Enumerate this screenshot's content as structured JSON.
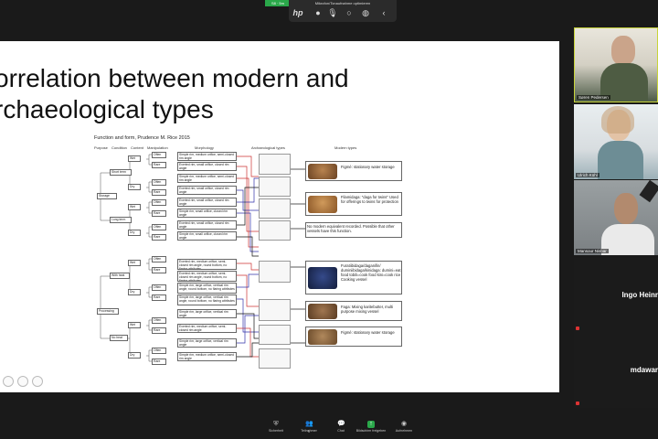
{
  "toolbar": {
    "green_tag": "S8 · 5m",
    "label": "Mikrofon/Tonaufnahme optimieren",
    "hp_icon": "hp"
  },
  "slide": {
    "title_line1": "orrelation between modern and",
    "title_line2": "rchaeological types",
    "subtitle": "Function and form, Prudence M. Rice 2015",
    "headers": {
      "purpose": "Purpose",
      "condition": "Condition",
      "content": "Content",
      "manipulation": "Manipulation",
      "morphology": "Morphology",
      "arch": "Archaeological types",
      "modern": "Modern types"
    },
    "nodes": {
      "storage": "Storage",
      "short_term": "Short term",
      "long_term": "Long term",
      "processing": "Processing",
      "with_heat": "With heat",
      "no_heat": "No heat",
      "wet": "Wet",
      "dry": "Dry",
      "often": "Often",
      "rare": "Rare"
    },
    "morph": [
      "Simple rim, medium orifice, semi-closed rim angle",
      "Everted rim, small orifice, closed rim angle",
      "Simple rim, medium orifice, semi-closed rim angle",
      "Everted rim, small orifice, closed rim angle",
      "Everted rim, small orifice, closed rim angle",
      "Simple rim, small orifice, closed rim angle",
      "Everted rim, small orifice, closed rim angle",
      "Simple rim, small orifice, closed rim angle",
      "Everted rim, medium orifice, semi-closed rim angle, round bottom, no flaring attributes",
      "Everted rim, medium orifice, semi-closed rim angle, round bottom, no flaring attributes",
      "Simple rim, large orifice, vertical rim angle, round bottom, no flaring attributes",
      "Simple rim, large orifice, vertical rim angle, round bottom, no flaring attributes",
      "Simple rim, large orifice, vertical rim angle",
      "Everted rim, medium orifice, semi-closed rim angle",
      "Simple rim, large orifice, vertical rim angle",
      "Simple rim, medium orifice, semi-closed rim angle"
    ],
    "modern": [
      "Figmé: stationary water storage",
      "Filamidaga: \"daga for twins\" Used for offerings to twins for protection",
      "No modern equivalent recorded. Possible that other vessels have this function.",
      "Furatiibidaga/daganifin/ duminiibidaga/kinidaga: dumini=eat food tobili=cook food kini=cook rice Cooking vessel",
      "Faga: Mixing karitebutter, multi purpose mixing vessel",
      "Figmé: stationary water storage"
    ]
  },
  "participants": [
    {
      "name": "Søren Pedersen"
    },
    {
      "name": "Ulrich Kühl"
    },
    {
      "name": "Mansour Nisbar"
    },
    {
      "name": "Ingo Heinr"
    },
    {
      "name": "mdawar"
    }
  ],
  "bottombar": {
    "items": [
      "Sicherheit",
      "Teilnehmer",
      "Chat",
      "Bildschirm freigeben",
      "Aufnehmen"
    ],
    "participant_count": "5"
  }
}
